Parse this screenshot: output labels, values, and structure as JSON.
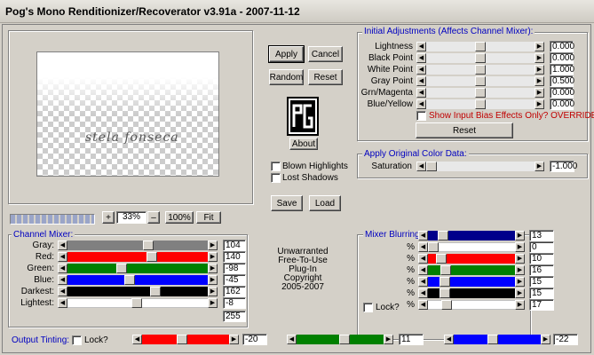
{
  "title": "Pog's Mono Renditionizer/Recoverator v3.91a - 2007-11-12",
  "preview": {
    "watermark": "stela fonseca"
  },
  "zoom": {
    "plus": "+",
    "value": "33%",
    "minus": "–",
    "hundred": "100%",
    "fit": "Fit"
  },
  "buttons": {
    "apply": "Apply",
    "cancel": "Cancel",
    "random": "Random",
    "reset": "Reset",
    "about": "About",
    "save": "Save",
    "load": "Load"
  },
  "logo": "PG",
  "initial": {
    "title": "Initial Adjustments (Affects Channel Mixer):",
    "rows": [
      {
        "label": "Lightness",
        "value": "0.000",
        "pos": 0.5
      },
      {
        "label": "Black Point",
        "value": "0.000",
        "pos": 0.5
      },
      {
        "label": "White Point",
        "value": "1.000",
        "pos": 0.5
      },
      {
        "label": "Gray Point",
        "value": "0.500",
        "pos": 0.5
      },
      {
        "label": "Grn/Magenta",
        "value": "0.000",
        "pos": 0.5
      },
      {
        "label": "Blue/Yellow",
        "value": "0.000",
        "pos": 0.5
      }
    ],
    "show_bias": "Show Input Bias Effects Only? OVERRIDE",
    "reset": "Reset"
  },
  "original": {
    "title": "Apply Original Color Data:",
    "label": "Saturation",
    "value": "-1.000",
    "pos": 0.0
  },
  "options": {
    "blown": "Blown Highlights",
    "lost": "Lost Shadows"
  },
  "channel": {
    "title": "Channel Mixer:",
    "rows": [
      {
        "label": "Gray:",
        "value": "104",
        "color": "#808080",
        "pos": 0.58
      },
      {
        "label": "Red:",
        "value": "140",
        "color": "#ff0000",
        "pos": 0.61
      },
      {
        "label": "Green:",
        "value": "-98",
        "color": "#008000",
        "pos": 0.38
      },
      {
        "label": "Blue:",
        "value": "-45",
        "color": "#0000ff",
        "pos": 0.44
      },
      {
        "label": "Darkest:",
        "value": "162",
        "color": "#000000",
        "pos": 0.64
      },
      {
        "label": "Lightest:",
        "value": "-8",
        "color": "#ffffff",
        "pos": 0.49
      }
    ],
    "total": "255"
  },
  "center_text": [
    "Unwarranted",
    "Free-To-Use",
    "Plug-In",
    "Copyright",
    "2005-2007"
  ],
  "mixer_blur": {
    "title": "Mixer Blurring:",
    "rows": [
      {
        "label": "",
        "value": "13",
        "color": "#00008b",
        "pos": 0.13
      },
      {
        "label": "%",
        "value": "0",
        "color": "#ffffff",
        "pos": 0.0
      },
      {
        "label": "%",
        "value": "10",
        "color": "#ff0000",
        "pos": 0.1
      },
      {
        "label": "%",
        "value": "16",
        "color": "#008000",
        "pos": 0.16
      },
      {
        "label": "%",
        "value": "15",
        "color": "#0000ff",
        "pos": 0.15
      },
      {
        "label": "%",
        "value": "15",
        "color": "#000000",
        "pos": 0.15
      },
      {
        "label": "%",
        "value": "17",
        "color": "#ffffff",
        "pos": 0.17
      }
    ],
    "lock": "Lock?"
  },
  "tinting": {
    "title": "Output Tinting:",
    "lock": "Lock?",
    "sliders": [
      {
        "color": "#ff0000",
        "value": "-20",
        "pos": 0.45
      },
      {
        "color": "#008000",
        "value": "11",
        "pos": 0.56
      },
      {
        "color": "#0000ff",
        "value": "-22",
        "pos": 0.44
      }
    ]
  }
}
